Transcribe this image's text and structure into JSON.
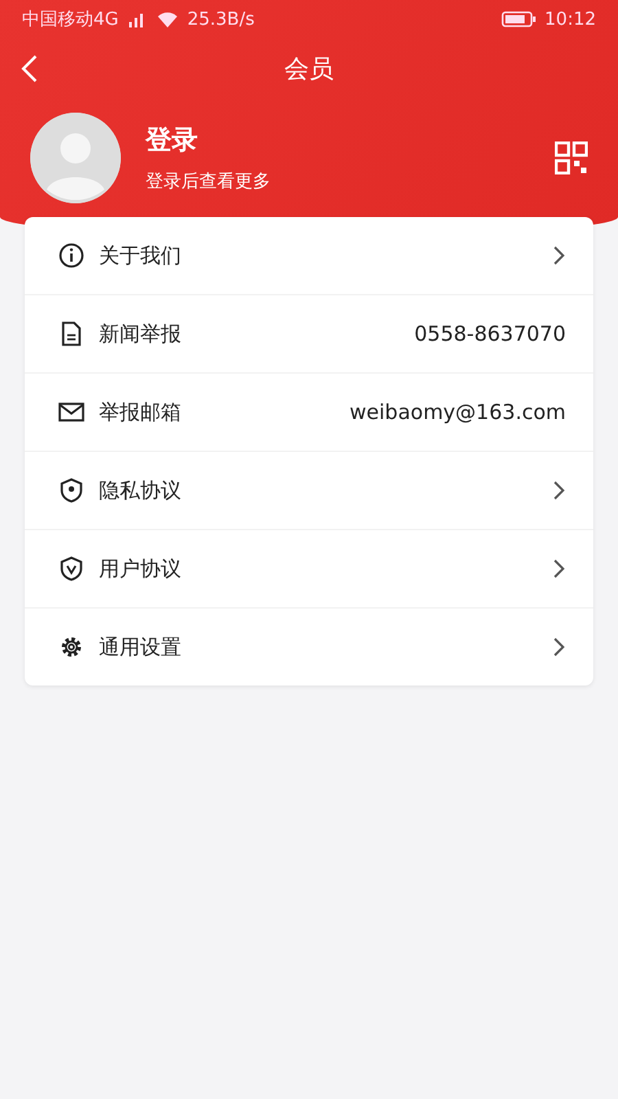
{
  "status_bar": {
    "carrier": "中国移动4G",
    "speed": "25.3B/s",
    "time": "10:12"
  },
  "header": {
    "title": "会员"
  },
  "profile": {
    "name": "登录",
    "subtitle": "登录后查看更多"
  },
  "menu": [
    {
      "kind": "link",
      "label": "关于我们"
    },
    {
      "kind": "value",
      "label": "新闻举报",
      "value": "0558-8637070"
    },
    {
      "kind": "value",
      "label": "举报邮箱",
      "value": "weibaomy@163.com"
    },
    {
      "kind": "link",
      "label": "隐私协议"
    },
    {
      "kind": "link",
      "label": "用户协议"
    },
    {
      "kind": "link",
      "label": "通用设置"
    }
  ]
}
